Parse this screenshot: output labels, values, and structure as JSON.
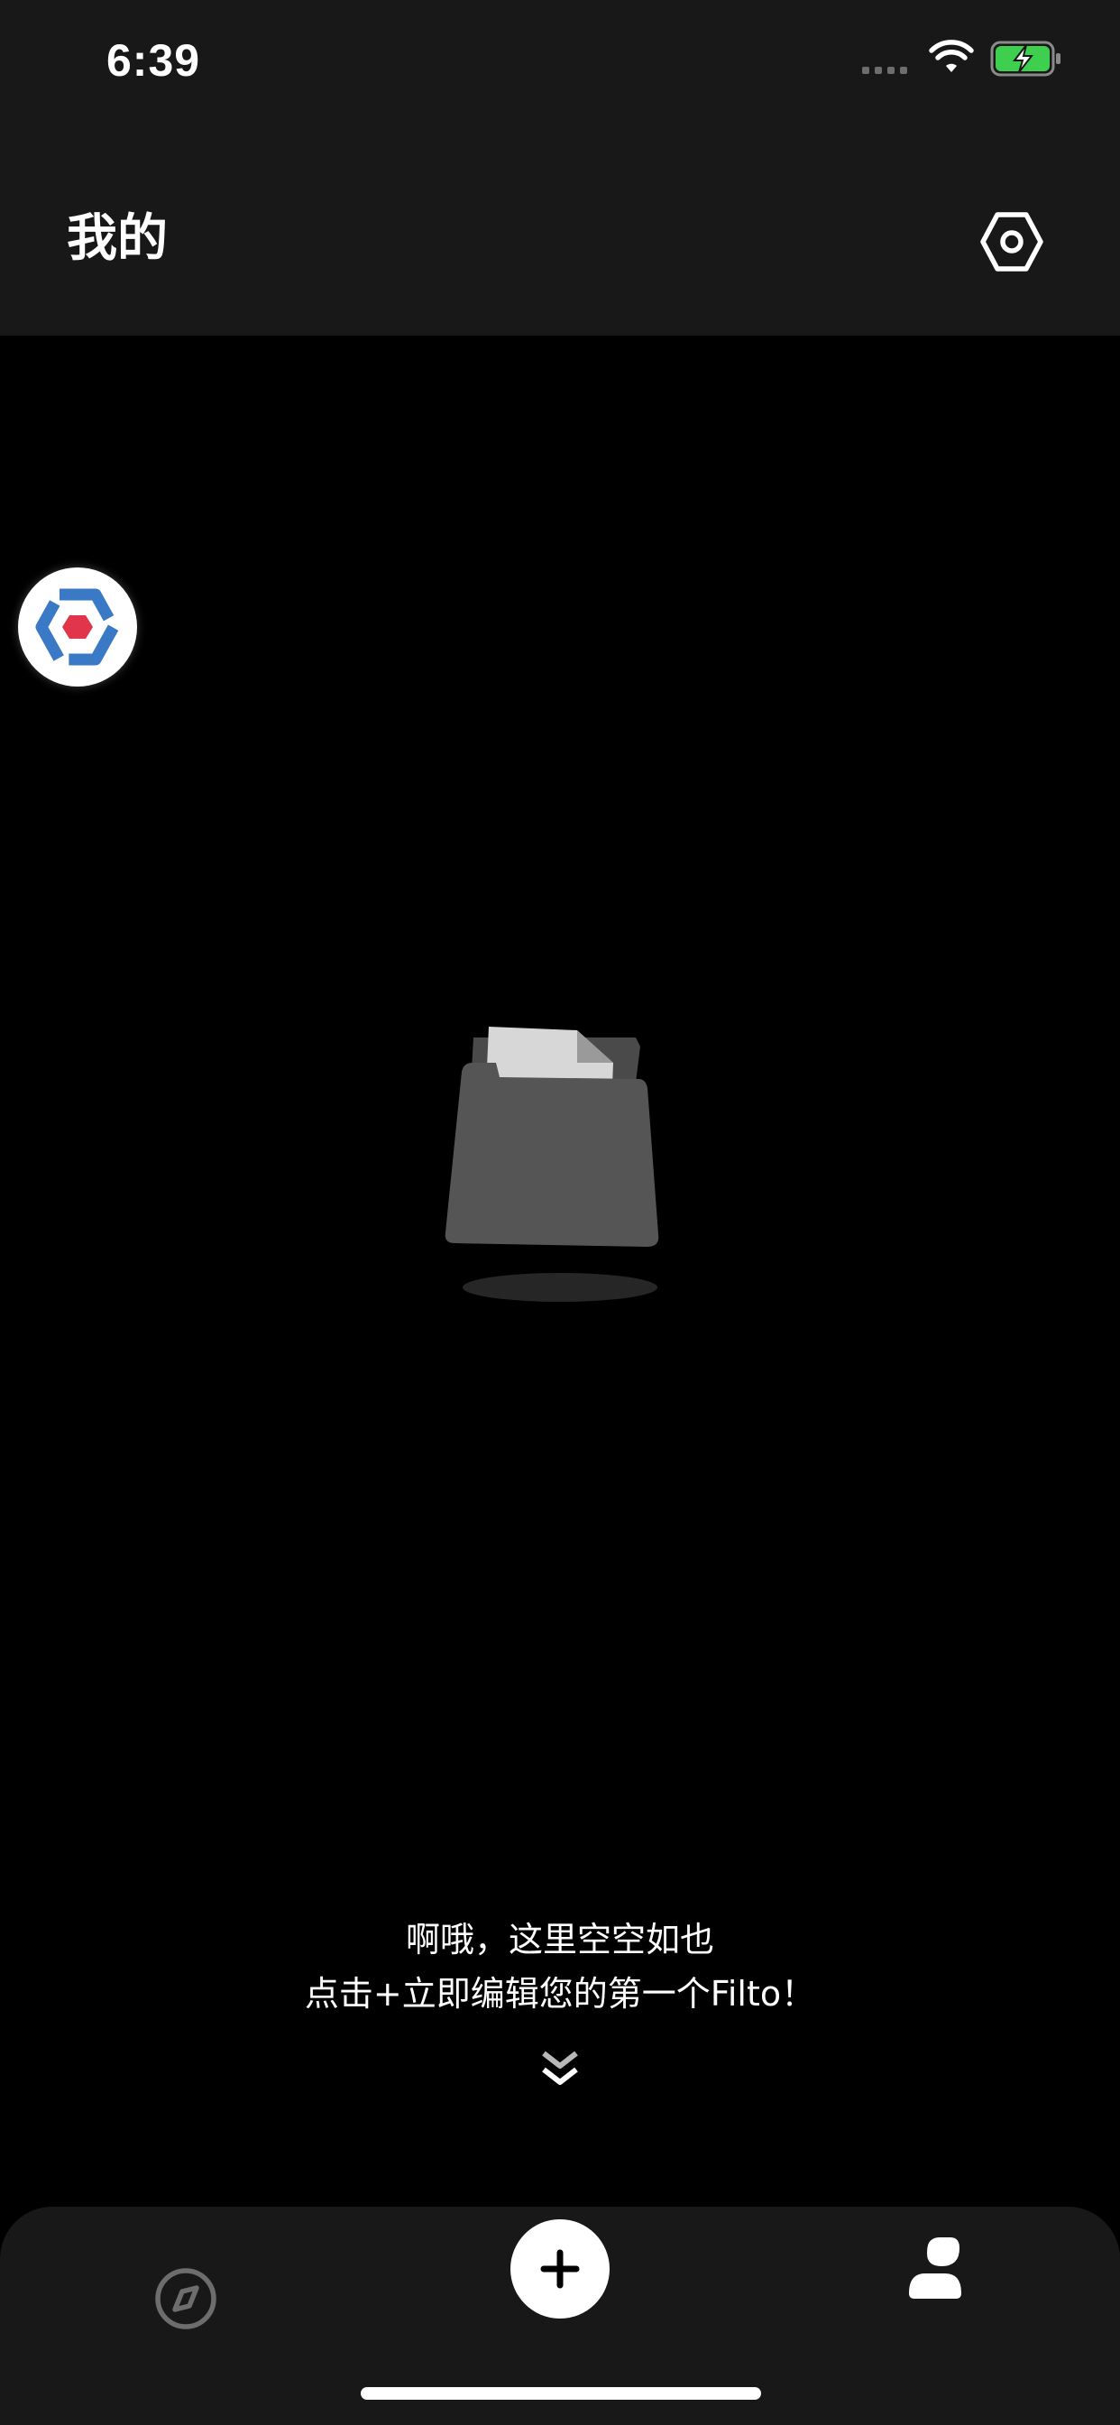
{
  "status_bar": {
    "time": "6:39",
    "icons": [
      "cellular-signal-icon",
      "wifi-icon",
      "battery-charging-icon"
    ]
  },
  "header": {
    "title": "我的",
    "settings_icon": "settings-hexagon-icon"
  },
  "floating_button": {
    "icon": "app-logo-hexagon-icon"
  },
  "empty_state": {
    "illustration": "empty-folder-icon",
    "line1": "啊哦，这里空空如也",
    "line2": "点击+立即编辑您的第一个Filto！",
    "hint_icon": "chevron-double-down-icon"
  },
  "tab_bar": {
    "tabs": [
      {
        "icon": "compass-icon",
        "active": false
      },
      {
        "icon": "plus-icon",
        "active": false
      },
      {
        "icon": "profile-icon",
        "active": true
      }
    ]
  },
  "colors": {
    "background": "#000000",
    "surface": "#181818",
    "text": "#ffffff",
    "inactive_icon": "#6d6d6d",
    "battery_green": "#3ecf4f",
    "logo_blue": "#3a79c6",
    "logo_red": "#e0354a"
  }
}
